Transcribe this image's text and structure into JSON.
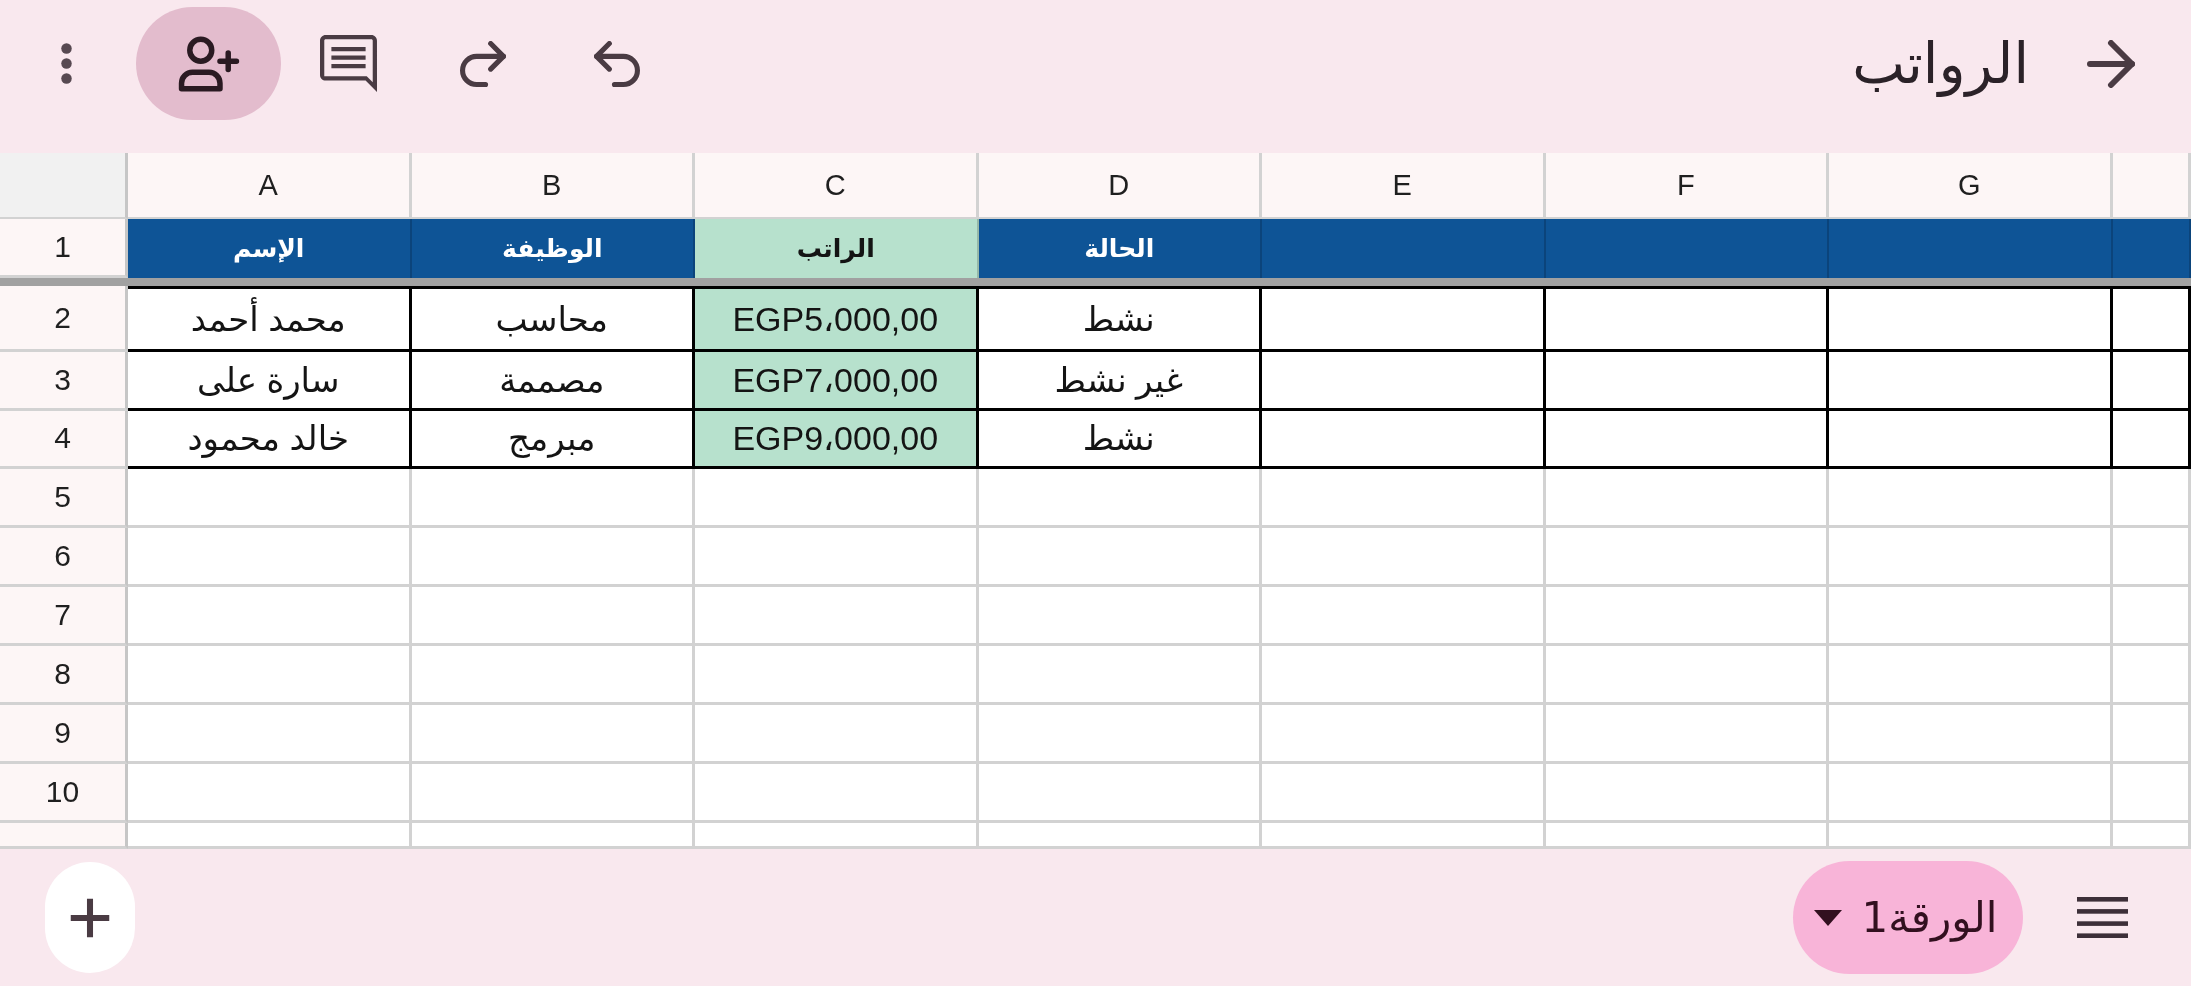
{
  "app_bar": {
    "title": "الرواتب"
  },
  "sheet": {
    "column_headers": [
      "G",
      "F",
      "E",
      "D",
      "C",
      "B",
      "A"
    ],
    "header_row": {
      "number": "1",
      "color": "#0e5496",
      "cells": [
        {
          "text": "الحالة"
        },
        {
          "text": "الراتب",
          "color": "#b7e1cd"
        },
        {
          "text": "الوظيفة"
        },
        {
          "text": "الإسم"
        }
      ]
    },
    "rows": [
      {
        "number": "2",
        "cells": [
          {
            "text": "نشط"
          },
          {
            "text": "EGP5،000,00",
            "color": "#b7e1cd"
          },
          {
            "text": "محاسب"
          },
          {
            "text": "محمد أحمد"
          }
        ]
      },
      {
        "number": "3",
        "cells": [
          {
            "text": "غير نشط"
          },
          {
            "text": "EGP7،000,00",
            "color": "#b7e1cd"
          },
          {
            "text": "مصممة"
          },
          {
            "text": "سارة على"
          }
        ]
      },
      {
        "number": "4",
        "cells": [
          {
            "text": "نشط"
          },
          {
            "text": "EGP9،000,00",
            "color": "#b7e1cd"
          },
          {
            "text": "مبرمج"
          },
          {
            "text": "خالد محمود"
          }
        ]
      }
    ],
    "empty_rows": [
      "5",
      "6",
      "7",
      "8",
      "9",
      "10"
    ]
  },
  "sheet_tabs": [
    {
      "label": "الورقة1",
      "selected": true
    }
  ]
}
